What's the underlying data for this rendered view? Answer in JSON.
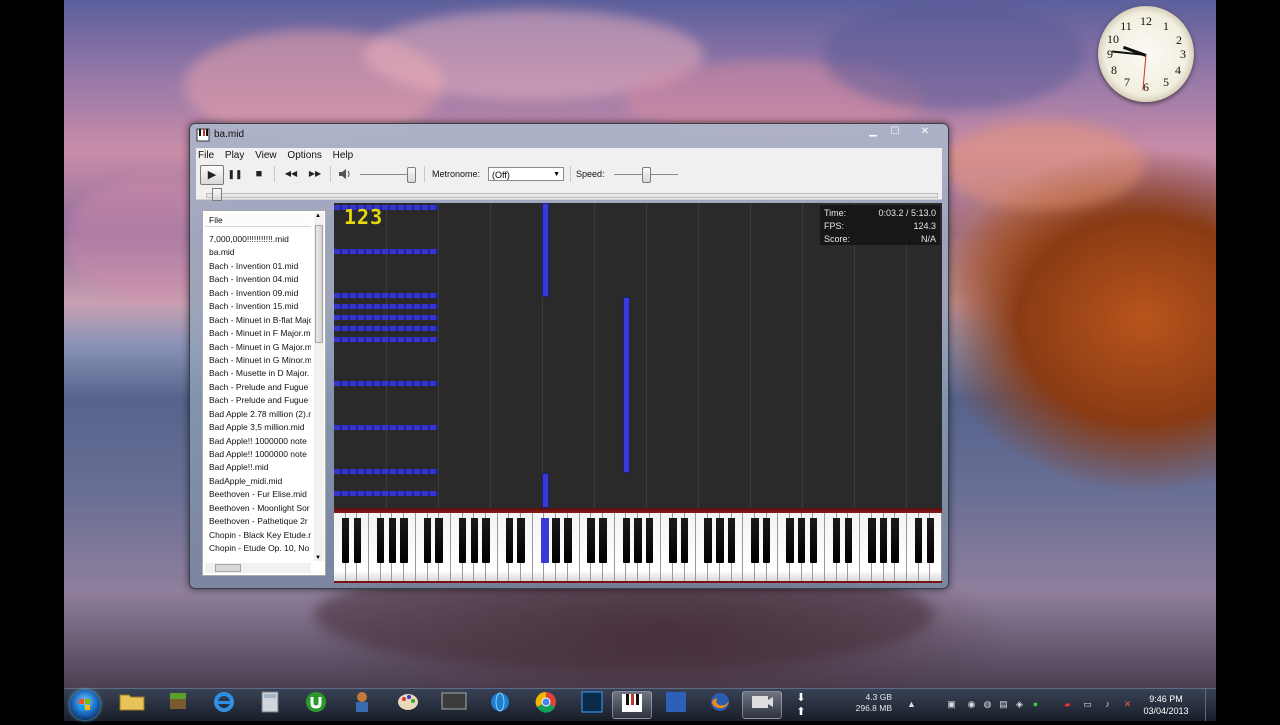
{
  "window": {
    "title": "ba.mid"
  },
  "menu": [
    "File",
    "Play",
    "View",
    "Options",
    "Help"
  ],
  "toolbar": {
    "play": "▶",
    "pause": "❚❚",
    "stop": "■",
    "rewind": "◀◀",
    "fast_forward": "▶▶",
    "volume_icon": "speaker-icon",
    "metronome_label": "Metronome:",
    "metronome_value": "(Off)",
    "speed_label": "Speed:"
  },
  "filelist": {
    "header": "File",
    "items": [
      "7,000,000!!!!!!!!!!!.mid",
      "ba.mid",
      "Bach - Invention 01.mid",
      "Bach - Invention 04.mid",
      "Bach - Invention 09.mid",
      "Bach - Invention 15.mid",
      "Bach - Minuet in B-flat Majo",
      "Bach - Minuet in F Major.m",
      "Bach - Minuet in G Major.m",
      "Bach - Minuet in G Minor.m",
      "Bach - Musette in D Major.",
      "Bach - Prelude and Fugue i",
      "Bach - Prelude and Fugue i",
      "Bad Apple 2.78 million (2).m",
      "Bad Apple 3,5 million.mid",
      "Bad Apple!! 1000000 note",
      "Bad Apple!! 1000000 note",
      "Bad Apple!!.mid",
      "BadApple_midi.mid",
      "Beethoven - Fur Elise.mid",
      "Beethoven - Moonlight Sor",
      "Beethoven - Pathetique 2r",
      "Chopin - Black Key Etude.m",
      "Chopin - Etude Op. 10, No"
    ]
  },
  "roll": {
    "counter": "123",
    "stats": {
      "time_label": "Time:",
      "time_value": "0:03.2 / 5:13.0",
      "fps_label": "FPS:",
      "fps_value": "124.3",
      "score_label": "Score:",
      "score_value": "N/A"
    }
  },
  "clock_gadget": {
    "numbers": [
      "12",
      "1",
      "2",
      "3",
      "4",
      "5",
      "6",
      "7",
      "8",
      "9",
      "10",
      "11"
    ]
  },
  "taskbar": {
    "memory_gb": "4.3 GB",
    "memory_mb": "296.8 MB",
    "time": "9:46 PM",
    "date": "03/04/2013"
  },
  "colors": {
    "note_blue": "#3a3ad8",
    "counter_yellow": "#e8d80a",
    "keyboard_red": "#7a1010"
  }
}
